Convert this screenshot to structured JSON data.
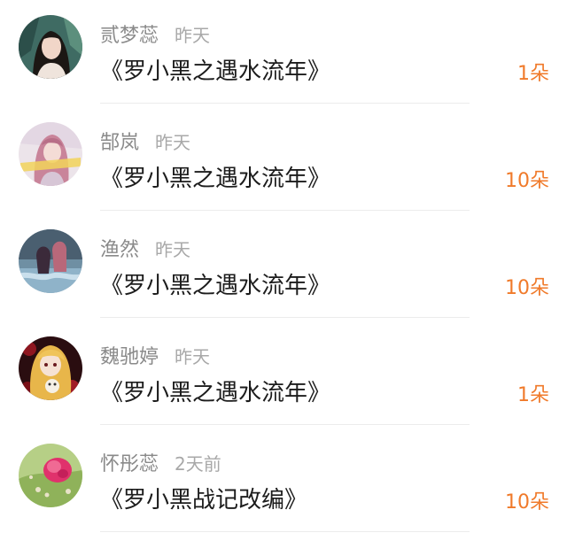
{
  "items": [
    {
      "name": "贰梦蕊",
      "time": "昨天",
      "title": "《罗小黑之遇水流年》",
      "count": "1朵",
      "avatar": "woman-portrait-avatar"
    },
    {
      "name": "郜岚",
      "time": "昨天",
      "title": "《罗小黑之遇水流年》",
      "count": "10朵",
      "avatar": "pink-hair-girl-avatar"
    },
    {
      "name": "渔然",
      "time": "昨天",
      "title": "《罗小黑之遇水流年》",
      "count": "10朵",
      "avatar": "two-anime-girls-water-avatar"
    },
    {
      "name": "魏驰婷",
      "time": "昨天",
      "title": "《罗小黑之遇水流年》",
      "count": "1朵",
      "avatar": "blonde-anime-girl-avatar"
    },
    {
      "name": "怀彤蕊",
      "time": "2天前",
      "title": "《罗小黑战记改编》",
      "count": "10朵",
      "avatar": "pink-cactus-flower-avatar"
    }
  ]
}
